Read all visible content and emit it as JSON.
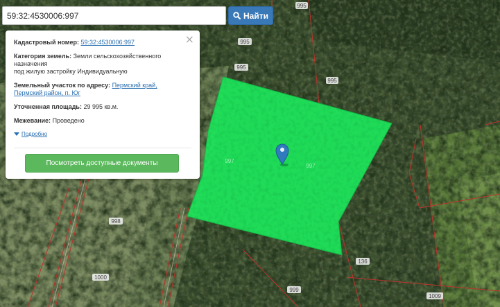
{
  "search": {
    "value": "59:32:4530006:997",
    "button_label": "Найти"
  },
  "popup": {
    "close_symbol": "×",
    "cadastral_label": "Кадастровый номер:",
    "cadastral_value": "59:32:4530006:997",
    "category_label": "Категория земель:",
    "category_value_line1": "Земли сельскохозяйственного",
    "category_value_line2": "назначения",
    "category_value_line3": "под жилую застройку Индивидуальную",
    "address_label": "Земельный участок по адресу:",
    "address_line1": "Пермский край,",
    "address_line2": "Пермский район, п. Юг",
    "area_label": "Уточненная площадь:",
    "area_value": "29 995 кв.м.",
    "survey_label": "Межевание:",
    "survey_value": "Проведено",
    "more_label": "Подробно",
    "docs_button_label": "Посмотреть доступные документы"
  },
  "parcel_labels": [
    "995",
    "995",
    "995",
    "995",
    "997",
    "997",
    "998",
    "1000",
    "999",
    "136",
    "1009"
  ],
  "colors": {
    "selected_parcel": "#1ee35a",
    "boundary": "#c0322c",
    "marker": "#2f7bbd",
    "search_button": "#3a79b8",
    "docs_button": "#5bb85c",
    "link": "#2a6fb0"
  },
  "icons": [
    "search-icon",
    "close-icon",
    "map-marker-icon",
    "expand-triangle-icon"
  ]
}
